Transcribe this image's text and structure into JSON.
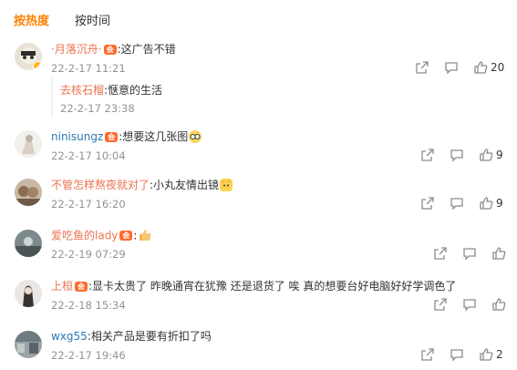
{
  "tabs": [
    {
      "label": "按热度",
      "active": true
    },
    {
      "label": "按时间",
      "active": false
    }
  ],
  "colors": {
    "accent": "#ff8200",
    "username": "#eb7350",
    "link": "#2c78b4",
    "meta": "#939393"
  },
  "comments": [
    {
      "user": "·月落沉舟·",
      "vip": true,
      "text": ":这广告不错",
      "time": "22-2-17 11:21",
      "likes": "20",
      "reply": {
        "user": "去核石榴",
        "text": ":惬意的生活",
        "time": "22-2-17 23:38"
      }
    },
    {
      "user": "ninisungz",
      "vip": true,
      "text": ":想要这几张图",
      "emoji": "glasses-emoji",
      "time": "22-2-17 10:04",
      "likes": "9"
    },
    {
      "user": "不管怎样熬夜就对了",
      "vip": false,
      "text": ":小丸友情出镜",
      "emoji": "cat-emoji",
      "time": "22-2-17 16:20",
      "likes": "9"
    },
    {
      "user": "爱吃鱼的lady",
      "vip": true,
      "text": ":",
      "emoji": "thumbs-up-emoji",
      "time": "22-2-19 07:29",
      "likes": ""
    },
    {
      "user": "上桓",
      "vip": true,
      "text": ":显卡太贵了 昨晚通宵在犹豫 还是退货了 唉 真的想要台好电脑好好学调色了",
      "time": "22-2-18 15:34",
      "likes": ""
    },
    {
      "user": "wxg55",
      "vip": false,
      "text": ":相关产品是要有折扣了吗",
      "time": "22-2-17 19:46",
      "likes": "2"
    }
  ]
}
